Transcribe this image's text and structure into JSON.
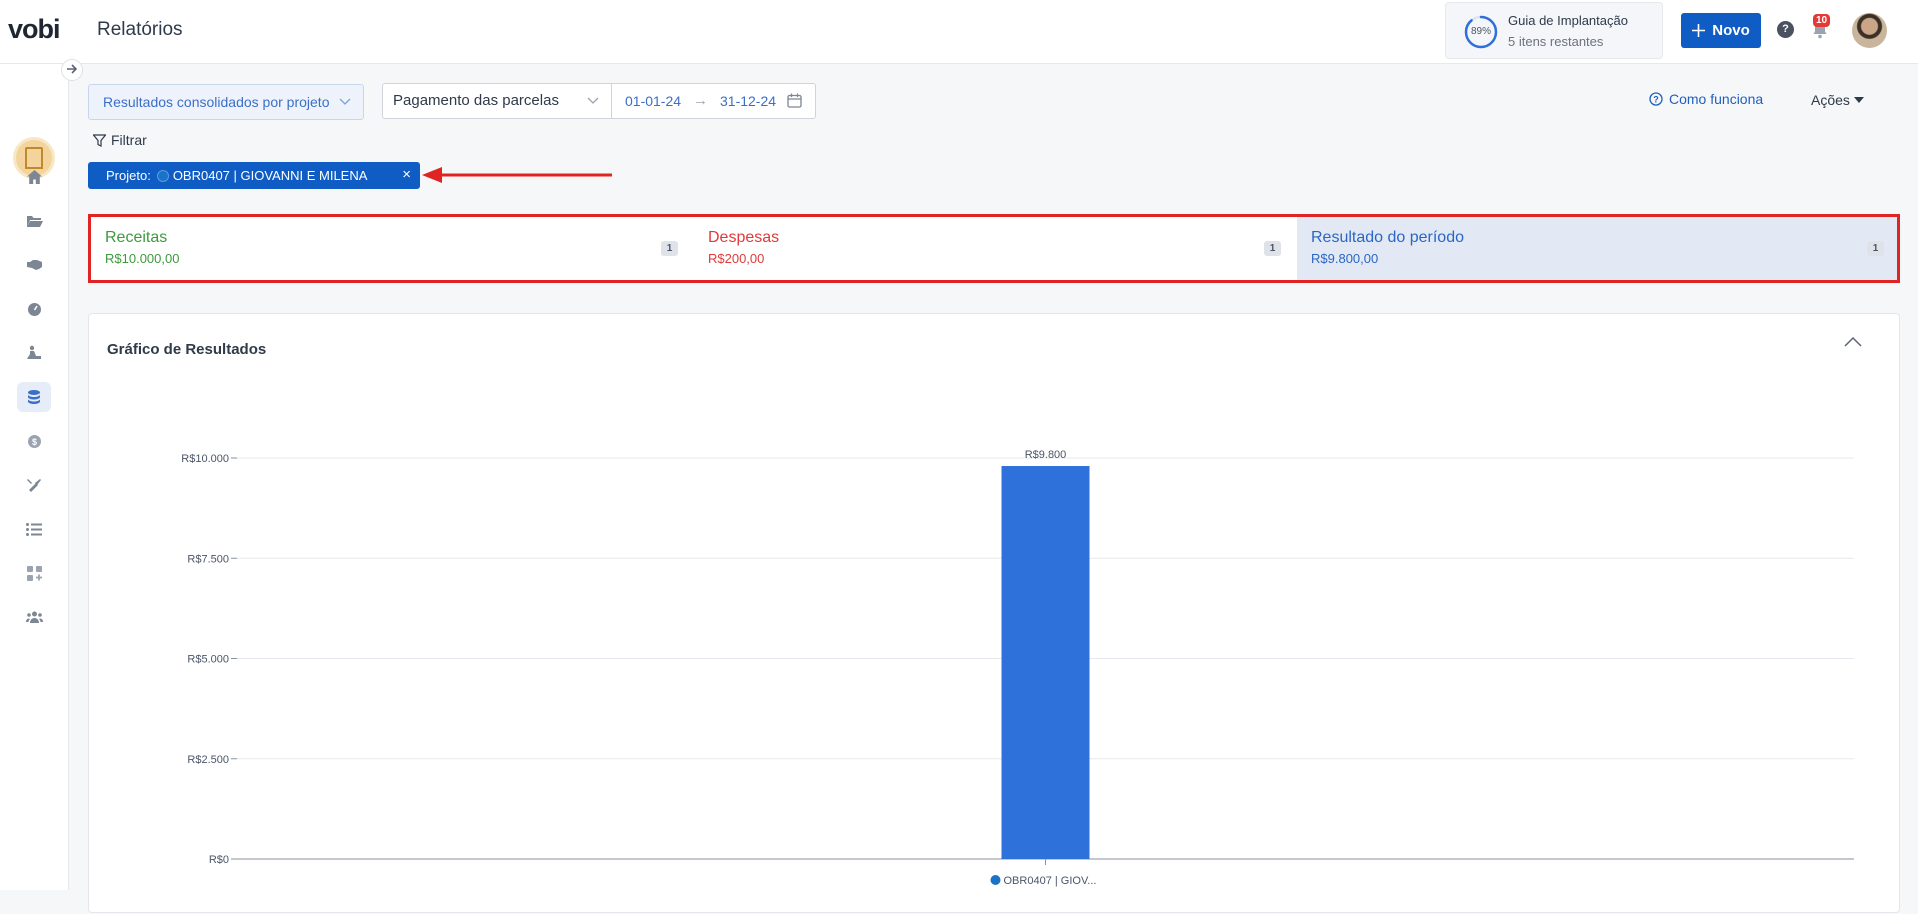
{
  "header": {
    "logo": "vobi",
    "page_title": "Relatórios",
    "guide": {
      "percent": "89%",
      "title": "Guia de Implantação",
      "subtitle": "5 itens restantes",
      "progress": 0.89
    },
    "new_button": "Novo",
    "help_icon": "question-icon",
    "notification_count": "10"
  },
  "sidebar": {
    "items": [
      {
        "icon": "home-icon"
      },
      {
        "icon": "folder-icon"
      },
      {
        "icon": "handshake-icon"
      },
      {
        "icon": "gauge-icon"
      },
      {
        "icon": "worker-icon"
      },
      {
        "icon": "database-icon",
        "active": true
      },
      {
        "icon": "dollar-icon"
      },
      {
        "icon": "tools-icon"
      },
      {
        "icon": "list-icon"
      },
      {
        "icon": "apps-icon"
      },
      {
        "icon": "team-icon"
      }
    ]
  },
  "toolbar": {
    "report_type": "Resultados consolidados por projeto",
    "period_type": "Pagamento das parcelas",
    "date_start": "01-01-24",
    "date_end": "31-12-24",
    "how_it_works": "Como funciona",
    "actions": "Ações",
    "filter": "Filtrar"
  },
  "filter_chip": {
    "label": "Projeto:",
    "value": "OBR0407 | GIOVANNI E MILENA",
    "close": "×"
  },
  "summary": {
    "revenue": {
      "label": "Receitas",
      "value": "R$10.000,00",
      "count": "1"
    },
    "expenses": {
      "label": "Despesas",
      "value": "R$200,00",
      "count": "1"
    },
    "result": {
      "label": "Resultado do período",
      "value": "R$9.800,00",
      "count": "1"
    }
  },
  "chart": {
    "title": "Gráfico de Resultados"
  },
  "chart_data": {
    "type": "bar",
    "categories": [
      "OBR0407 | GIOV..."
    ],
    "values": [
      9800
    ],
    "data_labels": [
      "R$9.800"
    ],
    "y_ticks": [
      0,
      2500,
      5000,
      7500,
      10000
    ],
    "y_tick_labels": [
      "R$0",
      "R$2.500",
      "R$5.000",
      "R$7.500",
      "R$10.000"
    ],
    "ylim": [
      0,
      10000
    ],
    "grid": true,
    "legend_marker_color": "#1a73c6",
    "bar_color": "#2f71db"
  },
  "colors": {
    "primary": "#0f5cc4",
    "revenue": "#3d9a3d",
    "expense": "#e03a3a",
    "result": "#2a66c4",
    "annotation": "#e02424"
  }
}
